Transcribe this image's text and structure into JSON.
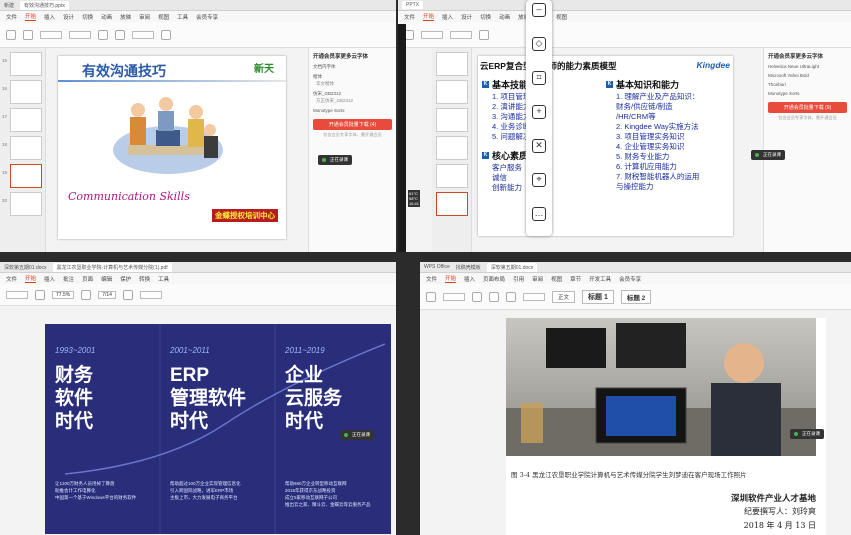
{
  "q1": {
    "tabs": [
      "新建",
      "有效沟通技巧.pptx"
    ],
    "menu": [
      "文件",
      "开始",
      "插入",
      "设计",
      "切换",
      "动画",
      "放映",
      "审阅",
      "视图",
      "工具",
      "会员专享"
    ],
    "menu_selected": "开始",
    "slide_title": "有效沟通技巧",
    "slide_logo": "新天",
    "slide_subtitle": "Communication Skills",
    "slide_badge": "金蝶授权培训中心",
    "thumb_numbers": [
      "15",
      "16",
      "17",
      "18",
      "19",
      "20",
      "21"
    ],
    "panel": {
      "title": "开通会员享更多云字体",
      "section": "文档内字体",
      "f1": "楷体",
      "f1_note": "华文楷体",
      "f2": "仿宋_GB2312",
      "f2_note": "方正仿宋_GB2312",
      "f3": "Monotype Sorts",
      "button": "开通会员批量下载 (4)",
      "note": "包含会员专享字体，需开通会员"
    },
    "toast": "正在录课"
  },
  "q2": {
    "menu": [
      "文件",
      "开始",
      "插入",
      "设计",
      "切换",
      "动画",
      "放映",
      "审阅",
      "视图"
    ],
    "menu_selected": "开始",
    "slide_head": "云ERP复合型工程师的能力素质模型",
    "slide_brand": "Kingdee",
    "left_head": "基本技能",
    "left_items": [
      "1. 项目管理能力",
      "2. 演讲能力",
      "3. 沟通能力",
      "4. 业务诊断能力",
      "5. 问题解决能力"
    ],
    "left_head2": "核心素质",
    "left_items2": [
      "客户服务",
      "诚信",
      "创新能力"
    ],
    "right_head": "基本知识和能力",
    "right_items": [
      "1. 理解产业及产品知识：",
      "财务/供应链/制造",
      "/HR/CRM等",
      "2. Kingdee Way实施方法",
      "3. 项目管理实务知识",
      "4. 企业管理实务知识",
      "5. 财务专业能力",
      "6. 计算机应用能力",
      "7. 财税智能机器人的运用",
      "与操控能力"
    ],
    "panel": {
      "title": "开通会员享更多云字体",
      "f1": "Helvetica Neue UltraLight",
      "f2": "Microsoft Yahei Bold",
      "f3": "Thonburi",
      "f4": "Monotype Sorts",
      "button": "开通会员批量下载 (9)",
      "note": "包含会员专享字体，需开通会员"
    },
    "toast": "正在录课",
    "clock": "16:41",
    "weather": "61°C",
    "cpu": "58°C"
  },
  "q3": {
    "tabs": [
      "深软第五期01.docx",
      "黑龙江农垦职业学院-计算机与艺术传媒分院(1).pdf"
    ],
    "menu": [
      "文件",
      "开始",
      "插入",
      "批注",
      "页面",
      "编辑",
      "保护",
      "转换",
      "工具"
    ],
    "menu_selected": "开始",
    "zoom": "77.5%",
    "page": "7/14",
    "cols": [
      {
        "year": "1993~2001",
        "big": [
          "财务",
          "软件",
          "时代"
        ],
        "small": [
          "让1200万财务人员甩掉了算盘",
          "助推会计工作电算化",
          "中国第一个基于Windows平台的财务软件"
        ]
      },
      {
        "year": "2001~2011",
        "big": [
          "ERP",
          "管理软件",
          "时代"
        ],
        "small": [
          "帮助超过100万企业实现管理信息化",
          "引入跨国际战略，进军ERP市场",
          "主板上市，大力发展电子商务平台"
        ]
      },
      {
        "year": "2011~2019",
        "big": [
          "企业",
          "云服务",
          "时代"
        ],
        "small": [
          "帮助680万企业转型移动互联网",
          "2015年获得京东战略投资",
          "成立5家移动互联网子公司",
          "推出云之家、精斗云、金蝶云等云服务产品"
        ]
      }
    ],
    "toast": "正在录课"
  },
  "q4": {
    "tabs": [
      "WPS Office",
      "找稿壳模板",
      "深软第五期01.docx"
    ],
    "menu": [
      "文件",
      "开始",
      "插入",
      "页面布局",
      "引用",
      "审阅",
      "视图",
      "章节",
      "开发工具",
      "会员专享"
    ],
    "menu_selected": "开始",
    "styles": [
      "正文",
      "标题 1",
      "标题 2"
    ],
    "caption": "图 3-4 黑龙江农垦职业学院计算机与艺术传媒分院学生刘梦迪在客户现场工作照片",
    "sig1": "深圳软件产业人才基地",
    "sig2": "纪要撰写人：刘玲爽",
    "sig3": "2018 年 4 月 13 日",
    "toast": "正在录课"
  }
}
